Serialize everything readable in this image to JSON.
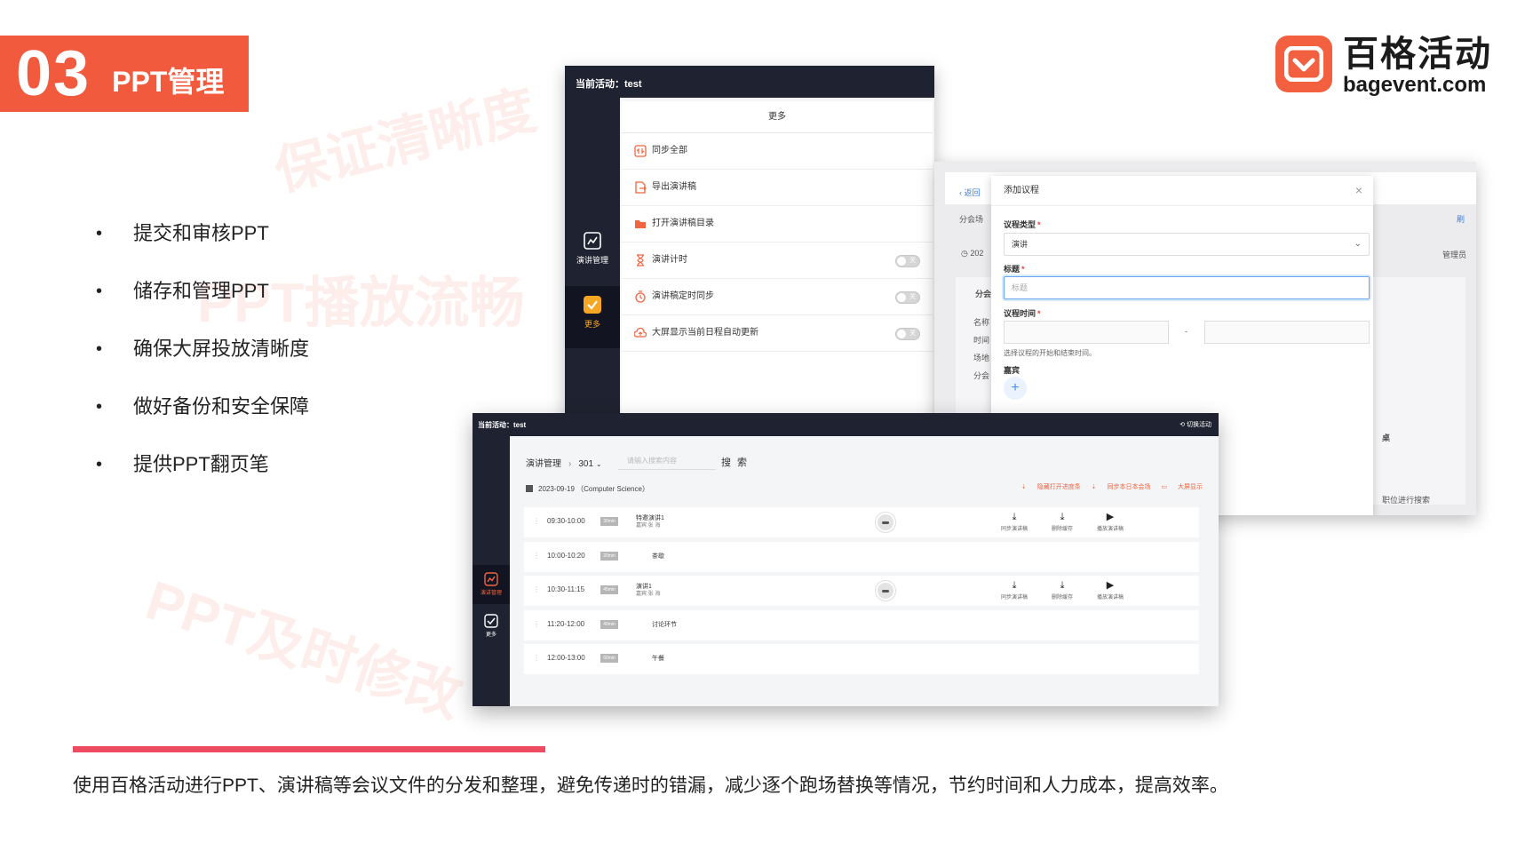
{
  "slide": {
    "number": "03",
    "title": "PPT管理",
    "logo": {
      "cn": "百格活动",
      "en": "bagevent.com",
      "color": "#f2603f"
    },
    "watermarks": [
      "保证清晰度",
      "PPT播放流畅",
      "PPT及时修改"
    ],
    "bullets": [
      "提交和审核PPT",
      "储存和管理PPT",
      "确保大屏投放清晰度",
      "做好备份和安全保障",
      "提供PPT翻页笔"
    ],
    "caption": "使用百格活动进行PPT、演讲稿等会议文件的分发和整理，避免传递时的错漏，减少逐个跑场替换等情况，节约时间和人力成本，提高效率。",
    "accent": "#f25a3d"
  },
  "shot1": {
    "current_event": "当前活动：test",
    "nav": [
      {
        "label": "演讲管理",
        "icon": "chart-icon"
      },
      {
        "label": "更多",
        "icon": "checkbox-icon"
      }
    ],
    "header": "更多",
    "menu": [
      {
        "label": "同步全部",
        "icon": "sync-icon",
        "toggle": false
      },
      {
        "label": "导出演讲稿",
        "icon": "export-icon",
        "toggle": false
      },
      {
        "label": "打开演讲稿目录",
        "icon": "folder-icon",
        "toggle": false
      },
      {
        "label": "演讲计时",
        "icon": "hourglass-icon",
        "toggle": true,
        "state": "关"
      },
      {
        "label": "演讲稿定时同步",
        "icon": "timer-icon",
        "toggle": true,
        "state": "关"
      },
      {
        "label": "大屏显示当前日程自动更新",
        "icon": "cloud-icon",
        "toggle": true,
        "state": "关"
      }
    ]
  },
  "shot2": {
    "back": "返回",
    "bg": {
      "venue": "分会场",
      "year": "202",
      "session": "分会",
      "name": "名称",
      "time": "时间",
      "place": "场地",
      "hall": "分会",
      "refresh": "刷",
      "admin": "管理员",
      "col": "桌",
      "search_hint": "职位进行搜索"
    },
    "title": "添加议程",
    "type_label": "议程类型",
    "type_value": "演讲",
    "title_label": "标题",
    "title_placeholder": "标题",
    "time_label": "议程时间",
    "time_sep": "-",
    "time_hint": "选择议程的开始和结束时间。",
    "guest_label": "嘉宾"
  },
  "shot3": {
    "current_event": "当前活动：test",
    "switch": "切换活动",
    "nav": [
      {
        "label": "演讲管理",
        "icon": "chart-icon"
      },
      {
        "label": "更多",
        "icon": "checkbox-icon"
      }
    ],
    "crumb_root": "演讲管理",
    "crumb_room": "301",
    "search_placeholder": "请输入搜索内容",
    "search_button": "搜 索",
    "date": "2023-09-19 （Computer Science）",
    "actions": [
      "隐藏打开进度条",
      "同步本日本会场",
      "大屏显示"
    ],
    "op_labels": [
      "同步演讲稿",
      "删除缓存",
      "播放演讲稿"
    ],
    "rows": [
      {
        "time": "09:30-10:00",
        "dur": "30min",
        "name": "特邀演讲1",
        "sub": "嘉宾:张 海",
        "avatar": true
      },
      {
        "time": "10:00-10:20",
        "dur": "20min",
        "name": "茶歇",
        "sub": "",
        "avatar": false
      },
      {
        "time": "10:30-11:15",
        "dur": "45min",
        "name": "演讲1",
        "sub": "嘉宾:张 海",
        "avatar": true
      },
      {
        "time": "11:20-12:00",
        "dur": "40min",
        "name": "讨论环节",
        "sub": "",
        "avatar": false
      },
      {
        "time": "12:00-13:00",
        "dur": "60min",
        "name": "午餐",
        "sub": "",
        "avatar": false
      }
    ]
  }
}
